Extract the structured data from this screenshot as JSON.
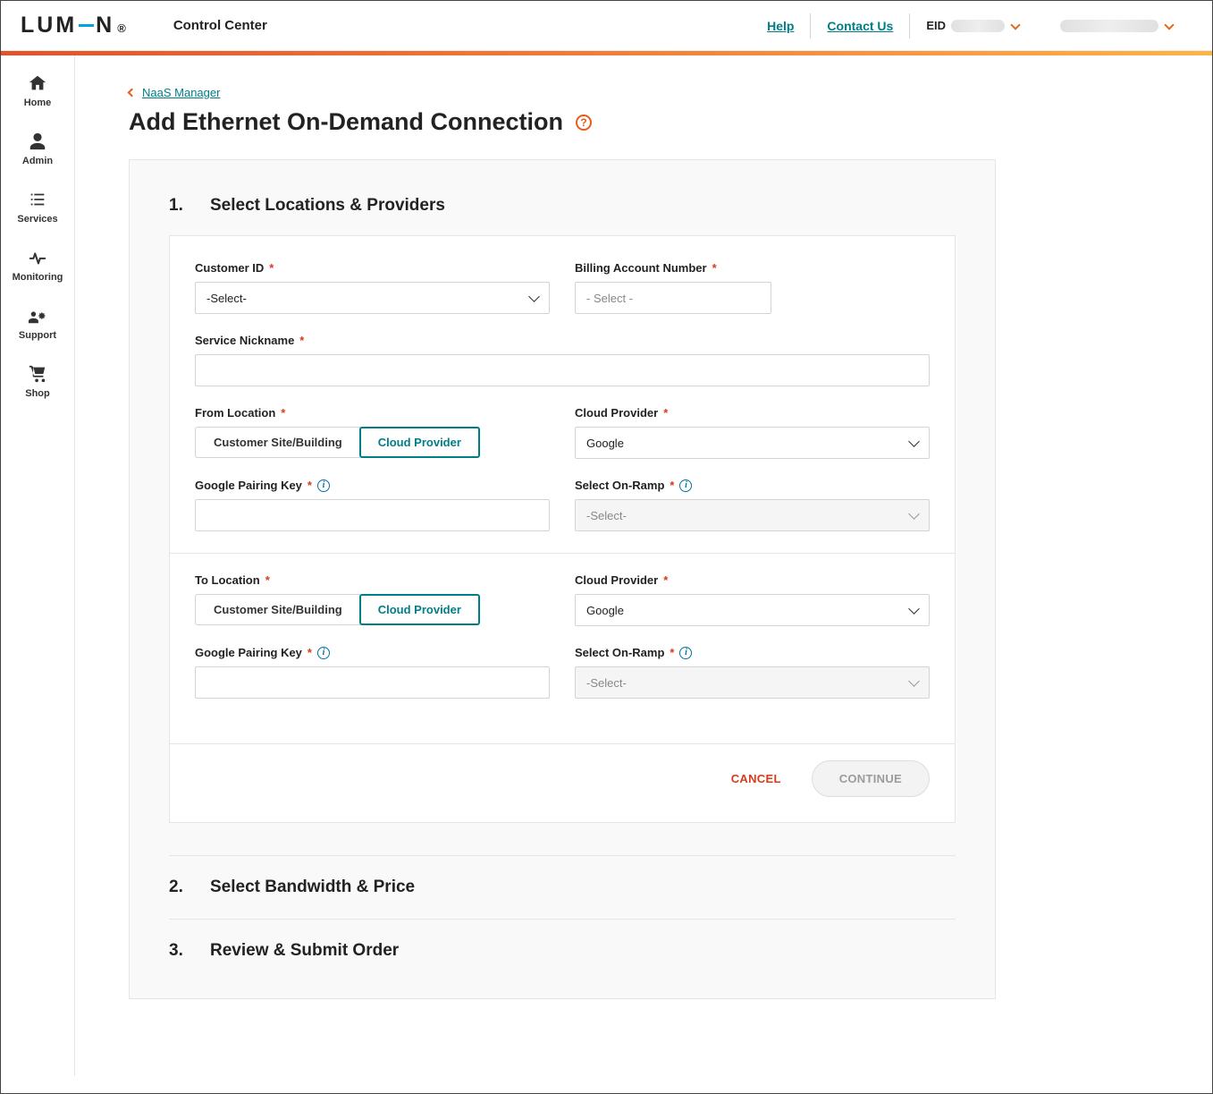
{
  "header": {
    "logo": "LUMEN",
    "title": "Control Center",
    "help": "Help",
    "contact": "Contact Us",
    "eid_label": "EID"
  },
  "sidebar": {
    "items": [
      {
        "label": "Home"
      },
      {
        "label": "Admin"
      },
      {
        "label": "Services"
      },
      {
        "label": "Monitoring"
      },
      {
        "label": "Support"
      },
      {
        "label": "Shop"
      }
    ]
  },
  "breadcrumb": " NaaS Manager",
  "page_title": "Add Ethernet On-Demand Connection",
  "steps": {
    "s1_num": "1.",
    "s1_title": "Select Locations & Providers",
    "s2_num": "2.",
    "s2_title": "Select Bandwidth & Price",
    "s3_num": "3.",
    "s3_title": "Review & Submit Order"
  },
  "form": {
    "customer_id": {
      "label": "Customer ID",
      "value": "-Select-"
    },
    "ban": {
      "label": "Billing Account Number",
      "placeholder": "- Select -"
    },
    "nickname": {
      "label": "Service Nickname",
      "value": ""
    },
    "from": {
      "label": "From Location",
      "seg_customer": "Customer Site/Building",
      "seg_cloud": "Cloud Provider",
      "provider_label": "Cloud Provider",
      "provider_value": "Google",
      "pairing_label": "Google Pairing Key",
      "pairing_value": "",
      "onramp_label": "Select On-Ramp",
      "onramp_value": "-Select-"
    },
    "to": {
      "label": "To Location",
      "seg_customer": "Customer Site/Building",
      "seg_cloud": "Cloud Provider",
      "provider_label": "Cloud Provider",
      "provider_value": "Google",
      "pairing_label": "Google Pairing Key",
      "pairing_value": "",
      "onramp_label": "Select On-Ramp",
      "onramp_value": "-Select-"
    }
  },
  "actions": {
    "cancel": "CANCEL",
    "continue": "CONTINUE"
  }
}
